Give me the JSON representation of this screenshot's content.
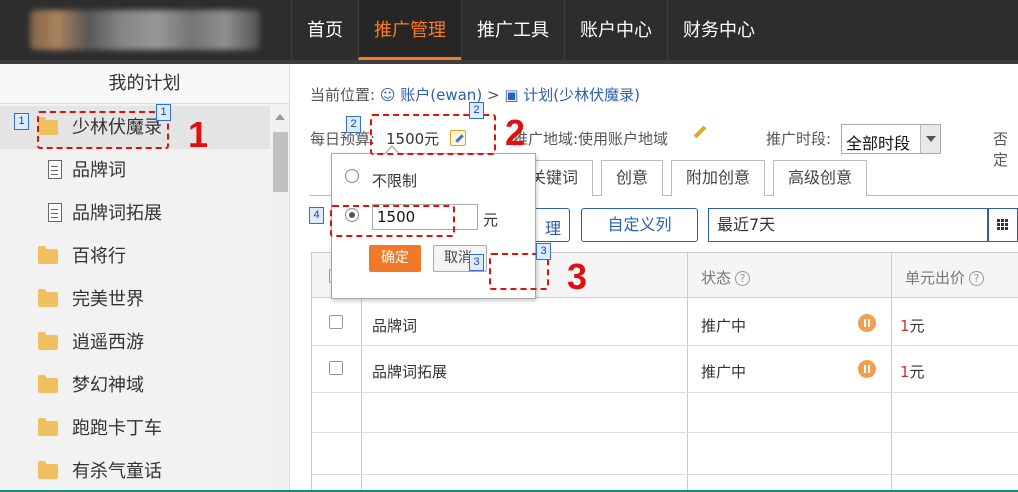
{
  "nav": {
    "items": [
      "首页",
      "推广管理",
      "推广工具",
      "账户中心",
      "财务中心"
    ],
    "active_index": 1,
    "accent": "#ff7a1f"
  },
  "sidebar": {
    "title": "我的计划",
    "items": [
      {
        "label": "少林伏魔录",
        "type": "folder",
        "selected": true
      },
      {
        "label": "品牌词",
        "type": "unit"
      },
      {
        "label": "品牌词拓展",
        "type": "unit"
      },
      {
        "label": "百将行",
        "type": "folder"
      },
      {
        "label": "完美世界",
        "type": "folder"
      },
      {
        "label": "逍遥西游",
        "type": "folder"
      },
      {
        "label": "梦幻神域",
        "type": "folder"
      },
      {
        "label": "跑跑卡丁车",
        "type": "folder"
      },
      {
        "label": "有杀气童话",
        "type": "folder"
      }
    ]
  },
  "breadcrumb": {
    "prefix": "当前位置:",
    "account": "账户(ewan)",
    "sep": ">",
    "plan": "计划(少林伏魔录)"
  },
  "info": {
    "budget_label": "每日预算:",
    "budget_value": "1500元",
    "region": "推广地域:使用账户地域",
    "time_label": "推广时段:",
    "time_value": "全部时段",
    "negative_label": "否定"
  },
  "tabs": [
    "关键词",
    "创意",
    "附加创意",
    "高级创意"
  ],
  "toolbar": {
    "partial_button": "理",
    "custom_columns": "自定义列",
    "date_range": "最近7天"
  },
  "table": {
    "columns": [
      "状态",
      "单元出价"
    ],
    "rows": [
      {
        "name": "品牌词",
        "status": "推广中",
        "bid_num": "1",
        "bid_unit": "元"
      },
      {
        "name": "品牌词拓展",
        "status": "推广中",
        "bid_num": "1",
        "bid_unit": "元"
      }
    ]
  },
  "popup": {
    "option_unlimited": "不限制",
    "input_value": "1500",
    "unit": "元",
    "ok_label": "确定",
    "cancel_label": "取消"
  },
  "annotations": {
    "big_labels": [
      "1",
      "2",
      "3"
    ],
    "tags": [
      "1",
      "1",
      "2",
      "2",
      "4",
      "3",
      "3"
    ],
    "color": "#e01010"
  }
}
